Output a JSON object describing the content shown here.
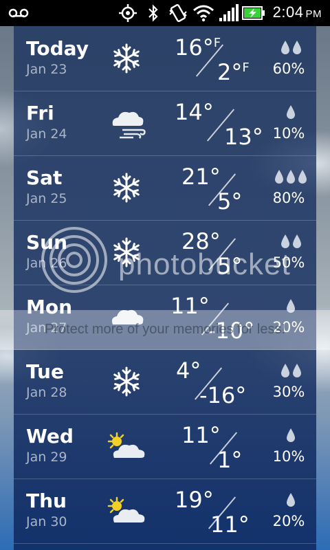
{
  "status_bar": {
    "voicemail_icon": "voicemail-icon",
    "gps_icon": "gps-icon",
    "bluetooth_icon": "bluetooth-icon",
    "vibrate_icon": "vibrate-icon",
    "wifi_icon": "wifi-icon",
    "signal_icon": "signal-icon",
    "battery_icon": "battery-charging-icon",
    "time": "2:04",
    "ampm": "PM"
  },
  "units": {
    "temp": "F"
  },
  "forecast": [
    {
      "day": "Today",
      "date": "Jan 23",
      "icon": "snowflake-icon",
      "hi": "16°",
      "lo": "2°",
      "unit": "F",
      "drops": 2,
      "precip": "60%"
    },
    {
      "day": "Fri",
      "date": "Jan 24",
      "icon": "windy-cloud-icon",
      "hi": "14°",
      "lo": "13°",
      "drops": 1,
      "precip": "10%"
    },
    {
      "day": "Sat",
      "date": "Jan 25",
      "icon": "snowflake-icon",
      "hi": "21°",
      "lo": "5°",
      "drops": 3,
      "precip": "80%"
    },
    {
      "day": "Sun",
      "date": "Jan 26",
      "icon": "snowflake-icon",
      "hi": "28°",
      "lo": "5°",
      "drops": 2,
      "precip": "50%"
    },
    {
      "day": "Mon",
      "date": "Jan 27",
      "icon": "cloud-icon",
      "hi": "11°",
      "lo": "-10°",
      "drops": 1,
      "precip": "20%"
    },
    {
      "day": "Tue",
      "date": "Jan 28",
      "icon": "snowflake-icon",
      "hi": "4°",
      "lo": "-16°",
      "drops": 2,
      "precip": "30%"
    },
    {
      "day": "Wed",
      "date": "Jan 29",
      "icon": "partly-sunny-icon",
      "hi": "11°",
      "lo": "1°",
      "drops": 1,
      "precip": "10%"
    },
    {
      "day": "Thu",
      "date": "Jan 30",
      "icon": "partly-sunny-icon",
      "hi": "19°",
      "lo": "11°",
      "drops": 1,
      "precip": "20%"
    }
  ],
  "watermark": {
    "brand": "photobucket",
    "tagline": "Protect more of your memories for less!"
  },
  "colors": {
    "panel": "#14305f",
    "date_text": "#aab6c8",
    "battery_green": "#3bd13b"
  }
}
